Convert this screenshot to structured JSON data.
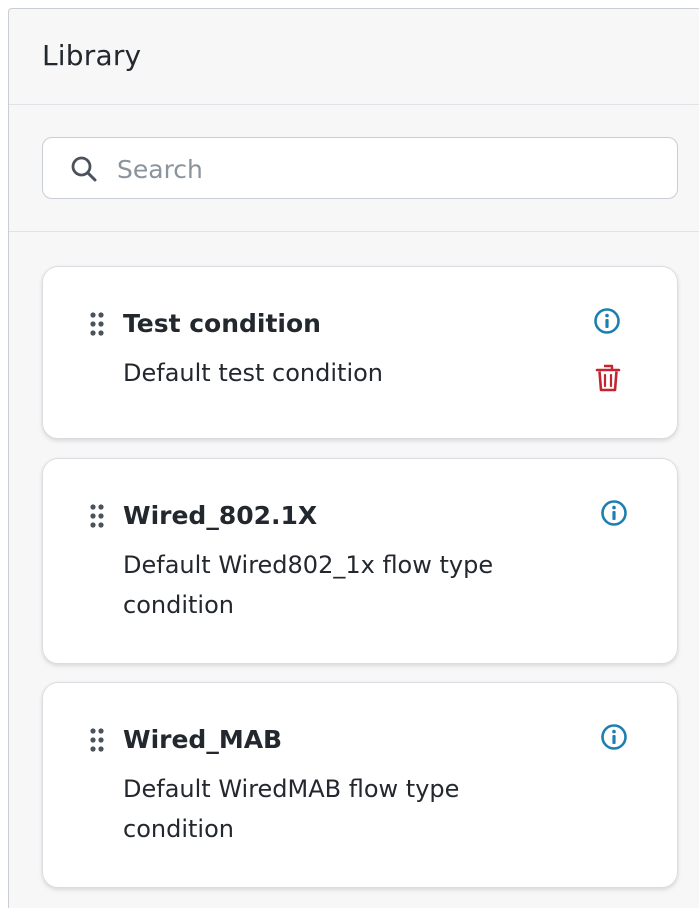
{
  "library": {
    "title": "Library",
    "search": {
      "placeholder": "Search",
      "value": ""
    },
    "items": [
      {
        "title": "Test condition",
        "description": "Default test condition",
        "actions": [
          "info-icon",
          "trash-icon"
        ]
      },
      {
        "title": "Wired_802.1X",
        "description": "Default Wired802_1x flow type condition",
        "actions": [
          "info-icon"
        ]
      },
      {
        "title": "Wired_MAB",
        "description": "Default WiredMAB flow type condition",
        "actions": [
          "info-icon"
        ]
      }
    ]
  },
  "colors": {
    "info": "#1d7fb0",
    "delete": "#c22630",
    "text": "#23282e",
    "placeholder": "#8b939d"
  }
}
